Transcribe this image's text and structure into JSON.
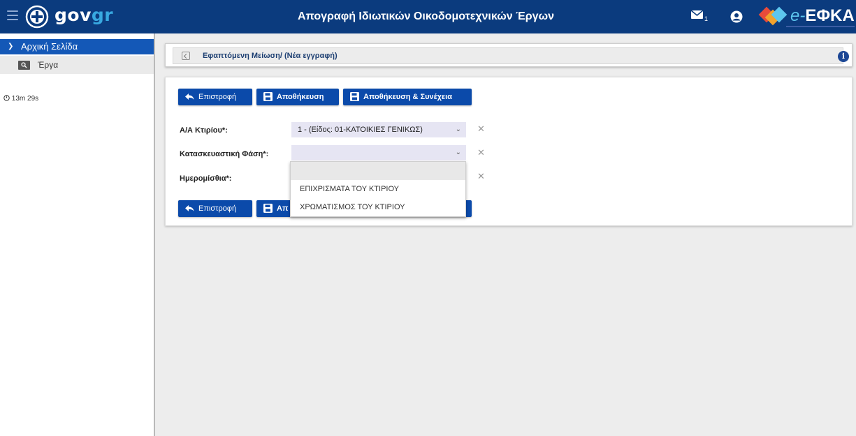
{
  "header": {
    "logo_text_main": "gov",
    "logo_text_accent": "gr",
    "title": "Απογραφή Ιδιωτικών Οικοδομοτεχνικών Έργων",
    "mail_count": "1",
    "efka_e": "e-",
    "efka_text": "ΕΦΚΑ",
    "brand_color": "#0b3b7e"
  },
  "sidebar": {
    "home_label": "Αρχική Σελίδα",
    "items": [
      {
        "label": "Έργα",
        "icon": "search-icon"
      }
    ],
    "timer": "13m 29s"
  },
  "breadcrumb": {
    "text": "Εφαπτόμενη Μείωση/ (Νέα εγγραφή)"
  },
  "toolbar": {
    "back_label": "Επιστροφή",
    "save_label": "Αποθήκευση",
    "save_continue_label": "Αποθήκευση & Συνέχεια"
  },
  "form": {
    "building_label": "Α/Α Κτιρίου*:",
    "building_value": "1 - (Είδος: 01-ΚΑΤΟΙΚΙΕΣ ΓΕΝΙΚΩΣ)",
    "phase_label": "Κατασκευαστική Φάση*:",
    "phase_value": "",
    "wages_label": "Ημερομίσθια*:",
    "phase_options": [
      "",
      "ΕΠΙΧΡΙΣΜΑΤΑ ΤΟΥ ΚΤΙΡΙΟΥ",
      "ΧΡΩΜΑΤΙΣΜΟΣ ΤΟΥ ΚΤΙΡΙΟΥ"
    ]
  },
  "bottom_toolbar": {
    "back_label": "Επιστροφή",
    "save_partial": "Απ"
  }
}
